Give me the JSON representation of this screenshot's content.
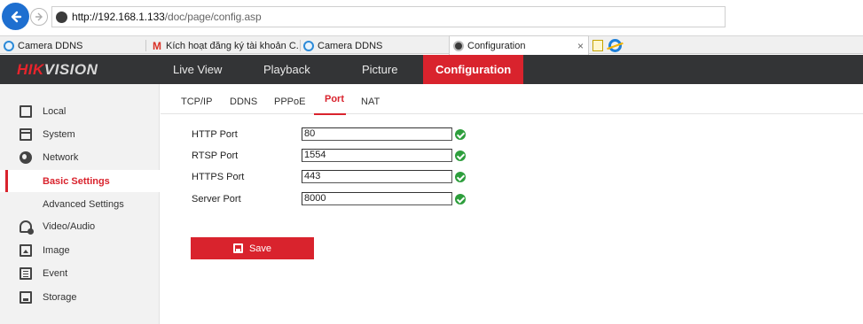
{
  "browser": {
    "url_host": "http://192.168.1.133",
    "url_path": "/doc/page/config.asp",
    "tabs": [
      {
        "label": "Camera DDNS"
      },
      {
        "label": "Kích hoạt đăng ký tài khoản C..."
      },
      {
        "label": "Camera DDNS"
      },
      {
        "label": "Configuration"
      }
    ],
    "close_glyph": "×"
  },
  "brand": {
    "hik": "HIK",
    "vision": "VISION"
  },
  "topnav": {
    "items": [
      {
        "label": "Live View"
      },
      {
        "label": "Playback"
      },
      {
        "label": "Picture"
      },
      {
        "label": "Configuration"
      }
    ]
  },
  "sidebar": {
    "items": [
      {
        "label": "Local",
        "icon": "monitor-icon"
      },
      {
        "label": "System",
        "icon": "system-icon"
      },
      {
        "label": "Network",
        "icon": "globe-icon"
      },
      {
        "label": "Basic Settings"
      },
      {
        "label": "Advanced Settings"
      },
      {
        "label": "Video/Audio",
        "icon": "video-audio-icon"
      },
      {
        "label": "Image",
        "icon": "image-icon"
      },
      {
        "label": "Event",
        "icon": "event-icon"
      },
      {
        "label": "Storage",
        "icon": "storage-icon"
      }
    ]
  },
  "subtabs": {
    "items": [
      {
        "label": "TCP/IP"
      },
      {
        "label": "DDNS"
      },
      {
        "label": "PPPoE"
      },
      {
        "label": "Port"
      },
      {
        "label": "NAT"
      }
    ]
  },
  "form": {
    "fields": [
      {
        "label": "HTTP Port",
        "value": "80"
      },
      {
        "label": "RTSP Port",
        "value": "1554"
      },
      {
        "label": "HTTPS Port",
        "value": "443"
      },
      {
        "label": "Server Port",
        "value": "8000"
      }
    ],
    "save_label": "Save"
  },
  "colors": {
    "accent": "#d9232d",
    "nav_bg": "#333436",
    "ok_green": "#2d9e3c",
    "sidebar_bg": "#f2f2f2"
  }
}
